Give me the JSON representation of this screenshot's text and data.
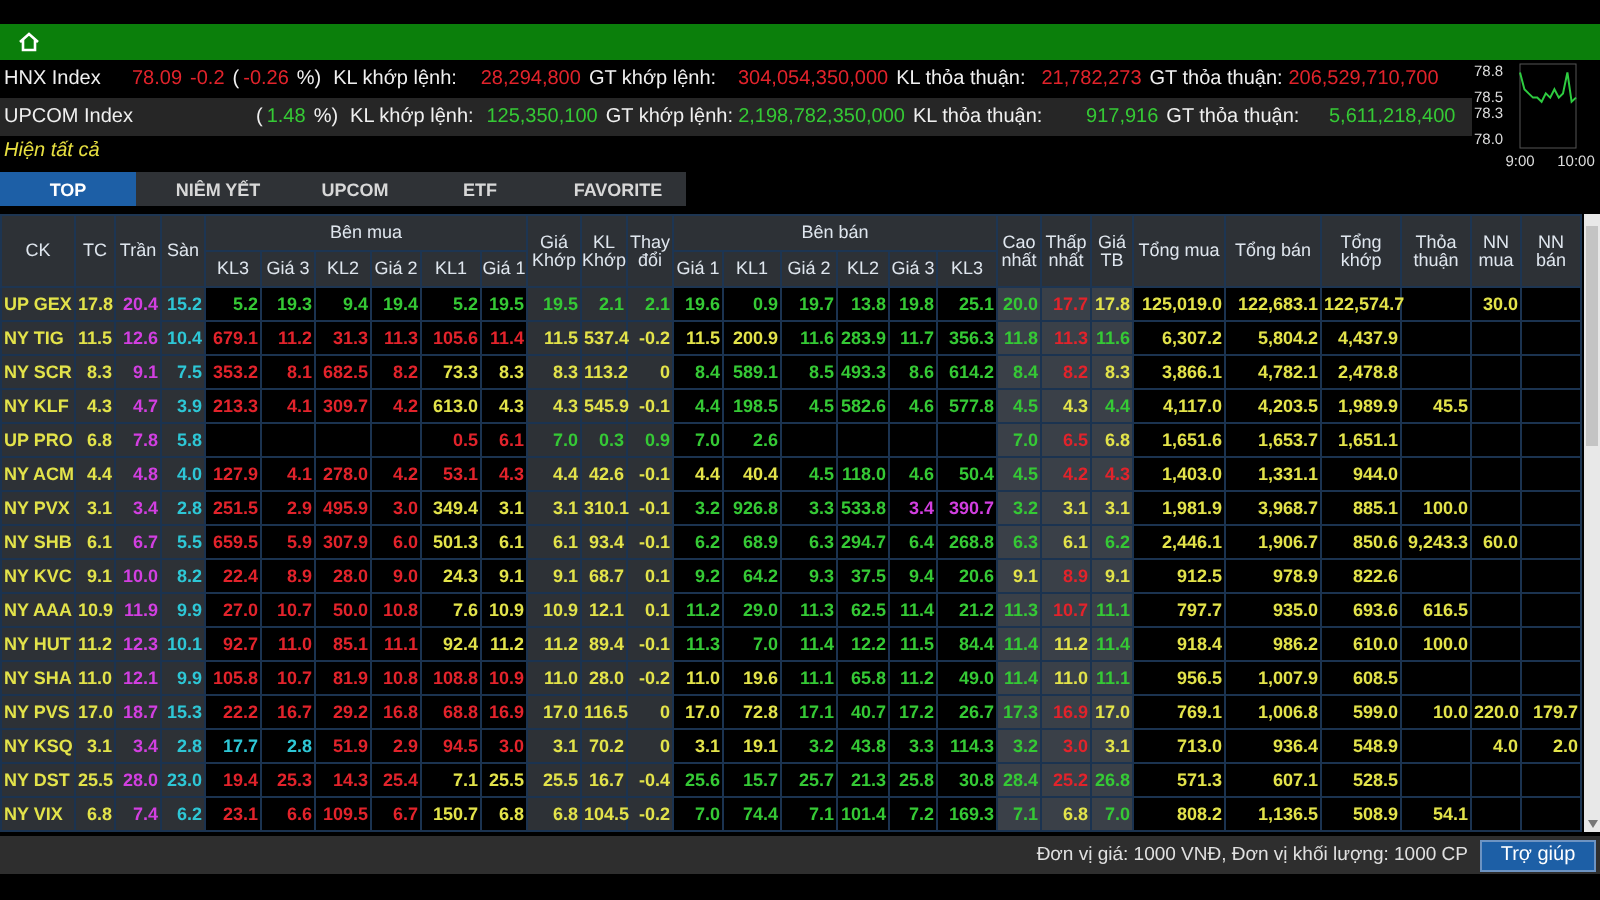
{
  "indices": [
    {
      "name": "HNX Index",
      "color": "#e2232b",
      "value": "78.09",
      "change": "-0.2",
      "pct_open": "(",
      "pct": "-0.26",
      "pct_close": "%)",
      "stats": [
        {
          "label": "KL khớp lệnh:",
          "value": "28,294,800"
        },
        {
          "label": "GT khớp lệnh:",
          "value": "304,054,350,000"
        },
        {
          "label": "KL thỏa thuận:",
          "value": "21,782,273"
        },
        {
          "label": "GT thỏa thuận:",
          "value": "206,529,710,700"
        }
      ]
    },
    {
      "name": "UPCOM Index",
      "color": "#35c935",
      "pct_open": "(",
      "pct": "1.48",
      "pct_close": "%)",
      "stats": [
        {
          "label": "KL khớp lệnh:",
          "value": "125,350,100"
        },
        {
          "label": "GT khớp lệnh:",
          "value": "2,198,782,350,000"
        },
        {
          "label": "KL thỏa thuận:",
          "value": "917,916"
        },
        {
          "label": "GT thỏa thuận:",
          "value": "5,611,218,400"
        }
      ]
    }
  ],
  "show_all": "Hiện tất cả",
  "mini_chart": {
    "chart_data": {
      "type": "line",
      "ylim": [
        77.9,
        78.9
      ],
      "yticks": [
        {
          "value": 78.0,
          "label": "78.0"
        },
        {
          "value": 78.3,
          "label": "78.3"
        },
        {
          "value": 78.5,
          "label": "78.5"
        },
        {
          "value": 78.8,
          "label": "78.8"
        }
      ],
      "categories": [
        "9:00",
        null,
        null,
        null,
        null,
        null,
        null,
        null,
        null,
        null,
        null,
        null,
        null,
        "10:00"
      ],
      "series": [
        {
          "color": "#2ecc40",
          "values": [
            78.8,
            78.6,
            78.55,
            78.5,
            78.5,
            78.45,
            78.55,
            78.5,
            78.6,
            78.5,
            78.55,
            78.8,
            78.45,
            78.5
          ]
        }
      ]
    }
  },
  "tabs": [
    {
      "label": "TOP",
      "selected": true
    },
    {
      "label": "NIÊM YẾT",
      "selected": false
    },
    {
      "label": "UPCOM",
      "selected": false
    },
    {
      "label": "ETF",
      "selected": false
    },
    {
      "label": "FAVORITE",
      "selected": false
    }
  ],
  "table": {
    "columns": [
      {
        "label": "CK"
      },
      {
        "label": "TC"
      },
      {
        "label": "Trần"
      },
      {
        "label": "Sàn"
      },
      {
        "label": "Bên mua",
        "colspan": 6,
        "children": [
          {
            "label": "KL3"
          },
          {
            "label": "Giá 3"
          },
          {
            "label": "KL2"
          },
          {
            "label": "Giá 2"
          },
          {
            "label": "KL1"
          },
          {
            "label": "Giá 1"
          }
        ]
      },
      {
        "label": "Giá Khớp"
      },
      {
        "label": "KL Khớp"
      },
      {
        "label": "Thay đổi"
      },
      {
        "label": "Bên bán",
        "colspan": 6,
        "children": [
          {
            "label": "Giá 1"
          },
          {
            "label": "KL1"
          },
          {
            "label": "Giá 2"
          },
          {
            "label": "KL2"
          },
          {
            "label": "Giá 3"
          },
          {
            "label": "KL3"
          }
        ]
      },
      {
        "label": "Cao nhất"
      },
      {
        "label": "Thấp nhất"
      },
      {
        "label": "Giá TB"
      },
      {
        "label": "Tổng mua"
      },
      {
        "label": "Tổng bán"
      },
      {
        "label": "Tổng khớp"
      },
      {
        "label": "Thỏa thuận"
      },
      {
        "label": "NN mua"
      },
      {
        "label": "NN bán"
      }
    ],
    "rows": [
      {
        "cells": [
          {
            "text": "UP GEX"
          },
          {
            "text": "17.8",
            "kind": "ref"
          },
          {
            "text": "20.4",
            "kind": "ceil"
          },
          {
            "text": "15.2",
            "kind": "floor"
          },
          {
            "text": "5.2",
            "kind": "up"
          },
          {
            "text": "19.3",
            "kind": "up"
          },
          {
            "text": "9.4",
            "kind": "up"
          },
          {
            "text": "19.4",
            "kind": "up"
          },
          {
            "text": "5.2",
            "kind": "up"
          },
          {
            "text": "19.5",
            "kind": "up"
          },
          {
            "text": "19.5",
            "kind": "up"
          },
          {
            "text": "2.1",
            "kind": "up"
          },
          {
            "text": "2.1",
            "kind": "up"
          },
          {
            "text": "19.6",
            "kind": "up"
          },
          {
            "text": "0.9",
            "kind": "up"
          },
          {
            "text": "19.7",
            "kind": "up"
          },
          {
            "text": "13.8",
            "kind": "up"
          },
          {
            "text": "19.8",
            "kind": "up"
          },
          {
            "text": "25.1",
            "kind": "up"
          },
          {
            "text": "20.0",
            "kind": "up"
          },
          {
            "text": "17.7",
            "kind": "down"
          },
          {
            "text": "17.8",
            "kind": "ref"
          },
          {
            "text": "125,019.0",
            "kind": "ref"
          },
          {
            "text": "122,683.1",
            "kind": "ref"
          },
          {
            "text": "122,574.7",
            "kind": "ref"
          },
          "",
          {
            "text": "30.0",
            "kind": "ref"
          },
          ""
        ]
      },
      {
        "cells": [
          {
            "text": "NY TIG"
          },
          {
            "text": "11.5",
            "kind": "ref"
          },
          {
            "text": "12.6",
            "kind": "ceil"
          },
          {
            "text": "10.4",
            "kind": "floor"
          },
          {
            "text": "679.1",
            "kind": "down"
          },
          {
            "text": "11.2",
            "kind": "down"
          },
          {
            "text": "31.3",
            "kind": "down"
          },
          {
            "text": "11.3",
            "kind": "down"
          },
          {
            "text": "105.6",
            "kind": "down"
          },
          {
            "text": "11.4",
            "kind": "down"
          },
          {
            "text": "11.5",
            "kind": "ref"
          },
          {
            "text": "537.4",
            "kind": "ref"
          },
          {
            "text": "-0.2",
            "kind": "ref"
          },
          {
            "text": "11.5",
            "kind": "ref"
          },
          {
            "text": "200.9",
            "kind": "ref"
          },
          {
            "text": "11.6",
            "kind": "up"
          },
          {
            "text": "283.9",
            "kind": "up"
          },
          {
            "text": "11.7",
            "kind": "up"
          },
          {
            "text": "356.3",
            "kind": "up"
          },
          {
            "text": "11.8",
            "kind": "up"
          },
          {
            "text": "11.3",
            "kind": "down"
          },
          {
            "text": "11.6",
            "kind": "up"
          },
          {
            "text": "6,307.2",
            "kind": "ref"
          },
          {
            "text": "5,804.2",
            "kind": "ref"
          },
          {
            "text": "4,437.9",
            "kind": "ref"
          },
          "",
          "",
          ""
        ]
      },
      {
        "cells": [
          {
            "text": "NY SCR"
          },
          {
            "text": "8.3",
            "kind": "ref"
          },
          {
            "text": "9.1",
            "kind": "ceil"
          },
          {
            "text": "7.5",
            "kind": "floor"
          },
          {
            "text": "353.2",
            "kind": "down"
          },
          {
            "text": "8.1",
            "kind": "down"
          },
          {
            "text": "682.5",
            "kind": "down"
          },
          {
            "text": "8.2",
            "kind": "down"
          },
          {
            "text": "73.3",
            "kind": "ref"
          },
          {
            "text": "8.3",
            "kind": "ref"
          },
          {
            "text": "8.3",
            "kind": "ref"
          },
          {
            "text": "113.2",
            "kind": "ref"
          },
          {
            "text": "0",
            "kind": "ref"
          },
          {
            "text": "8.4",
            "kind": "up"
          },
          {
            "text": "589.1",
            "kind": "up"
          },
          {
            "text": "8.5",
            "kind": "up"
          },
          {
            "text": "493.3",
            "kind": "up"
          },
          {
            "text": "8.6",
            "kind": "up"
          },
          {
            "text": "614.2",
            "kind": "up"
          },
          {
            "text": "8.4",
            "kind": "up"
          },
          {
            "text": "8.2",
            "kind": "down"
          },
          {
            "text": "8.3",
            "kind": "ref"
          },
          {
            "text": "3,866.1",
            "kind": "ref"
          },
          {
            "text": "4,782.1",
            "kind": "ref"
          },
          {
            "text": "2,478.8",
            "kind": "ref"
          },
          "",
          "",
          ""
        ]
      },
      {
        "cells": [
          {
            "text": "NY KLF"
          },
          {
            "text": "4.3",
            "kind": "ref"
          },
          {
            "text": "4.7",
            "kind": "ceil"
          },
          {
            "text": "3.9",
            "kind": "floor"
          },
          {
            "text": "213.3",
            "kind": "down"
          },
          {
            "text": "4.1",
            "kind": "down"
          },
          {
            "text": "309.7",
            "kind": "down"
          },
          {
            "text": "4.2",
            "kind": "down"
          },
          {
            "text": "613.0",
            "kind": "ref"
          },
          {
            "text": "4.3",
            "kind": "ref"
          },
          {
            "text": "4.3",
            "kind": "ref"
          },
          {
            "text": "545.9",
            "kind": "ref"
          },
          {
            "text": "-0.1",
            "kind": "ref"
          },
          {
            "text": "4.4",
            "kind": "up"
          },
          {
            "text": "198.5",
            "kind": "up"
          },
          {
            "text": "4.5",
            "kind": "up"
          },
          {
            "text": "582.6",
            "kind": "up"
          },
          {
            "text": "4.6",
            "kind": "up"
          },
          {
            "text": "577.8",
            "kind": "up"
          },
          {
            "text": "4.5",
            "kind": "up"
          },
          {
            "text": "4.3",
            "kind": "ref"
          },
          {
            "text": "4.4",
            "kind": "up"
          },
          {
            "text": "4,117.0",
            "kind": "ref"
          },
          {
            "text": "4,203.5",
            "kind": "ref"
          },
          {
            "text": "1,989.9",
            "kind": "ref"
          },
          {
            "text": "45.5",
            "kind": "ref"
          },
          "",
          ""
        ]
      },
      {
        "cells": [
          {
            "text": "UP PRO"
          },
          {
            "text": "6.8",
            "kind": "ref"
          },
          {
            "text": "7.8",
            "kind": "ceil"
          },
          {
            "text": "5.8",
            "kind": "floor"
          },
          "",
          "",
          "",
          "",
          {
            "text": "0.5",
            "kind": "down"
          },
          {
            "text": "6.1",
            "kind": "down"
          },
          {
            "text": "7.0",
            "kind": "up"
          },
          {
            "text": "0.3",
            "kind": "up"
          },
          {
            "text": "0.9",
            "kind": "up"
          },
          {
            "text": "7.0",
            "kind": "up"
          },
          {
            "text": "2.6",
            "kind": "up"
          },
          "",
          "",
          "",
          "",
          {
            "text": "7.0",
            "kind": "up"
          },
          {
            "text": "6.5",
            "kind": "down"
          },
          {
            "text": "6.8",
            "kind": "ref"
          },
          {
            "text": "1,651.6",
            "kind": "ref"
          },
          {
            "text": "1,653.7",
            "kind": "ref"
          },
          {
            "text": "1,651.1",
            "kind": "ref"
          },
          "",
          "",
          ""
        ]
      },
      {
        "cells": [
          {
            "text": "NY ACM"
          },
          {
            "text": "4.4",
            "kind": "ref"
          },
          {
            "text": "4.8",
            "kind": "ceil"
          },
          {
            "text": "4.0",
            "kind": "floor"
          },
          {
            "text": "127.9",
            "kind": "down"
          },
          {
            "text": "4.1",
            "kind": "down"
          },
          {
            "text": "278.0",
            "kind": "down"
          },
          {
            "text": "4.2",
            "kind": "down"
          },
          {
            "text": "53.1",
            "kind": "down"
          },
          {
            "text": "4.3",
            "kind": "down"
          },
          {
            "text": "4.4",
            "kind": "ref"
          },
          {
            "text": "42.6",
            "kind": "ref"
          },
          {
            "text": "-0.1",
            "kind": "ref"
          },
          {
            "text": "4.4",
            "kind": "ref"
          },
          {
            "text": "40.4",
            "kind": "ref"
          },
          {
            "text": "4.5",
            "kind": "up"
          },
          {
            "text": "118.0",
            "kind": "up"
          },
          {
            "text": "4.6",
            "kind": "up"
          },
          {
            "text": "50.4",
            "kind": "up"
          },
          {
            "text": "4.5",
            "kind": "up"
          },
          {
            "text": "4.2",
            "kind": "down"
          },
          {
            "text": "4.3",
            "kind": "down"
          },
          {
            "text": "1,403.0",
            "kind": "ref"
          },
          {
            "text": "1,331.1",
            "kind": "ref"
          },
          {
            "text": "944.0",
            "kind": "ref"
          },
          "",
          "",
          ""
        ]
      },
      {
        "cells": [
          {
            "text": "NY PVX"
          },
          {
            "text": "3.1",
            "kind": "ref"
          },
          {
            "text": "3.4",
            "kind": "ceil"
          },
          {
            "text": "2.8",
            "kind": "floor"
          },
          {
            "text": "251.5",
            "kind": "down"
          },
          {
            "text": "2.9",
            "kind": "down"
          },
          {
            "text": "495.9",
            "kind": "down"
          },
          {
            "text": "3.0",
            "kind": "down"
          },
          {
            "text": "349.4",
            "kind": "ref"
          },
          {
            "text": "3.1",
            "kind": "ref"
          },
          {
            "text": "3.1",
            "kind": "ref"
          },
          {
            "text": "310.1",
            "kind": "ref"
          },
          {
            "text": "-0.1",
            "kind": "ref"
          },
          {
            "text": "3.2",
            "kind": "up"
          },
          {
            "text": "926.8",
            "kind": "up"
          },
          {
            "text": "3.3",
            "kind": "up"
          },
          {
            "text": "533.8",
            "kind": "up"
          },
          {
            "text": "3.4",
            "kind": "ceil"
          },
          {
            "text": "390.7",
            "kind": "ceil"
          },
          {
            "text": "3.2",
            "kind": "up"
          },
          {
            "text": "3.1",
            "kind": "ref"
          },
          {
            "text": "3.1",
            "kind": "ref"
          },
          {
            "text": "1,981.9",
            "kind": "ref"
          },
          {
            "text": "3,968.7",
            "kind": "ref"
          },
          {
            "text": "885.1",
            "kind": "ref"
          },
          {
            "text": "100.0",
            "kind": "ref"
          },
          "",
          ""
        ]
      },
      {
        "cells": [
          {
            "text": "NY SHB"
          },
          {
            "text": "6.1",
            "kind": "ref"
          },
          {
            "text": "6.7",
            "kind": "ceil"
          },
          {
            "text": "5.5",
            "kind": "floor"
          },
          {
            "text": "659.5",
            "kind": "down"
          },
          {
            "text": "5.9",
            "kind": "down"
          },
          {
            "text": "307.9",
            "kind": "down"
          },
          {
            "text": "6.0",
            "kind": "down"
          },
          {
            "text": "501.3",
            "kind": "ref"
          },
          {
            "text": "6.1",
            "kind": "ref"
          },
          {
            "text": "6.1",
            "kind": "ref"
          },
          {
            "text": "93.4",
            "kind": "ref"
          },
          {
            "text": "-0.1",
            "kind": "ref"
          },
          {
            "text": "6.2",
            "kind": "up"
          },
          {
            "text": "68.9",
            "kind": "up"
          },
          {
            "text": "6.3",
            "kind": "up"
          },
          {
            "text": "294.7",
            "kind": "up"
          },
          {
            "text": "6.4",
            "kind": "up"
          },
          {
            "text": "268.8",
            "kind": "up"
          },
          {
            "text": "6.3",
            "kind": "up"
          },
          {
            "text": "6.1",
            "kind": "ref"
          },
          {
            "text": "6.2",
            "kind": "up"
          },
          {
            "text": "2,446.1",
            "kind": "ref"
          },
          {
            "text": "1,906.7",
            "kind": "ref"
          },
          {
            "text": "850.6",
            "kind": "ref"
          },
          {
            "text": "9,243.3",
            "kind": "ref"
          },
          {
            "text": "60.0",
            "kind": "ref"
          },
          ""
        ]
      },
      {
        "cells": [
          {
            "text": "NY KVC"
          },
          {
            "text": "9.1",
            "kind": "ref"
          },
          {
            "text": "10.0",
            "kind": "ceil"
          },
          {
            "text": "8.2",
            "kind": "floor"
          },
          {
            "text": "22.4",
            "kind": "down"
          },
          {
            "text": "8.9",
            "kind": "down"
          },
          {
            "text": "28.0",
            "kind": "down"
          },
          {
            "text": "9.0",
            "kind": "down"
          },
          {
            "text": "24.3",
            "kind": "ref"
          },
          {
            "text": "9.1",
            "kind": "ref"
          },
          {
            "text": "9.1",
            "kind": "ref"
          },
          {
            "text": "68.7",
            "kind": "ref"
          },
          {
            "text": "0.1",
            "kind": "ref"
          },
          {
            "text": "9.2",
            "kind": "up"
          },
          {
            "text": "64.2",
            "kind": "up"
          },
          {
            "text": "9.3",
            "kind": "up"
          },
          {
            "text": "37.5",
            "kind": "up"
          },
          {
            "text": "9.4",
            "kind": "up"
          },
          {
            "text": "20.6",
            "kind": "up"
          },
          {
            "text": "9.1",
            "kind": "ref"
          },
          {
            "text": "8.9",
            "kind": "down"
          },
          {
            "text": "9.1",
            "kind": "ref"
          },
          {
            "text": "912.5",
            "kind": "ref"
          },
          {
            "text": "978.9",
            "kind": "ref"
          },
          {
            "text": "822.6",
            "kind": "ref"
          },
          "",
          "",
          ""
        ]
      },
      {
        "cells": [
          {
            "text": "NY AAA"
          },
          {
            "text": "10.9",
            "kind": "ref"
          },
          {
            "text": "11.9",
            "kind": "ceil"
          },
          {
            "text": "9.9",
            "kind": "floor"
          },
          {
            "text": "27.0",
            "kind": "down"
          },
          {
            "text": "10.7",
            "kind": "down"
          },
          {
            "text": "50.0",
            "kind": "down"
          },
          {
            "text": "10.8",
            "kind": "down"
          },
          {
            "text": "7.6",
            "kind": "ref"
          },
          {
            "text": "10.9",
            "kind": "ref"
          },
          {
            "text": "10.9",
            "kind": "ref"
          },
          {
            "text": "12.1",
            "kind": "ref"
          },
          {
            "text": "0.1",
            "kind": "ref"
          },
          {
            "text": "11.2",
            "kind": "up"
          },
          {
            "text": "29.0",
            "kind": "up"
          },
          {
            "text": "11.3",
            "kind": "up"
          },
          {
            "text": "62.5",
            "kind": "up"
          },
          {
            "text": "11.4",
            "kind": "up"
          },
          {
            "text": "21.2",
            "kind": "up"
          },
          {
            "text": "11.3",
            "kind": "up"
          },
          {
            "text": "10.7",
            "kind": "down"
          },
          {
            "text": "11.1",
            "kind": "up"
          },
          {
            "text": "797.7",
            "kind": "ref"
          },
          {
            "text": "935.0",
            "kind": "ref"
          },
          {
            "text": "693.6",
            "kind": "ref"
          },
          {
            "text": "616.5",
            "kind": "ref"
          },
          "",
          ""
        ]
      },
      {
        "cells": [
          {
            "text": "NY HUT"
          },
          {
            "text": "11.2",
            "kind": "ref"
          },
          {
            "text": "12.3",
            "kind": "ceil"
          },
          {
            "text": "10.1",
            "kind": "floor"
          },
          {
            "text": "92.7",
            "kind": "down"
          },
          {
            "text": "11.0",
            "kind": "down"
          },
          {
            "text": "85.1",
            "kind": "down"
          },
          {
            "text": "11.1",
            "kind": "down"
          },
          {
            "text": "92.4",
            "kind": "ref"
          },
          {
            "text": "11.2",
            "kind": "ref"
          },
          {
            "text": "11.2",
            "kind": "ref"
          },
          {
            "text": "89.4",
            "kind": "ref"
          },
          {
            "text": "-0.1",
            "kind": "ref"
          },
          {
            "text": "11.3",
            "kind": "up"
          },
          {
            "text": "7.0",
            "kind": "up"
          },
          {
            "text": "11.4",
            "kind": "up"
          },
          {
            "text": "12.2",
            "kind": "up"
          },
          {
            "text": "11.5",
            "kind": "up"
          },
          {
            "text": "84.4",
            "kind": "up"
          },
          {
            "text": "11.4",
            "kind": "up"
          },
          {
            "text": "11.2",
            "kind": "ref"
          },
          {
            "text": "11.4",
            "kind": "up"
          },
          {
            "text": "918.4",
            "kind": "ref"
          },
          {
            "text": "986.2",
            "kind": "ref"
          },
          {
            "text": "610.0",
            "kind": "ref"
          },
          {
            "text": "100.0",
            "kind": "ref"
          },
          "",
          ""
        ]
      },
      {
        "cells": [
          {
            "text": "NY SHA"
          },
          {
            "text": "11.0",
            "kind": "ref"
          },
          {
            "text": "12.1",
            "kind": "ceil"
          },
          {
            "text": "9.9",
            "kind": "floor"
          },
          {
            "text": "105.8",
            "kind": "down"
          },
          {
            "text": "10.7",
            "kind": "down"
          },
          {
            "text": "81.9",
            "kind": "down"
          },
          {
            "text": "10.8",
            "kind": "down"
          },
          {
            "text": "108.8",
            "kind": "down"
          },
          {
            "text": "10.9",
            "kind": "down"
          },
          {
            "text": "11.0",
            "kind": "ref"
          },
          {
            "text": "28.0",
            "kind": "ref"
          },
          {
            "text": "-0.2",
            "kind": "ref"
          },
          {
            "text": "11.0",
            "kind": "ref"
          },
          {
            "text": "19.6",
            "kind": "ref"
          },
          {
            "text": "11.1",
            "kind": "up"
          },
          {
            "text": "65.8",
            "kind": "up"
          },
          {
            "text": "11.2",
            "kind": "up"
          },
          {
            "text": "49.0",
            "kind": "up"
          },
          {
            "text": "11.4",
            "kind": "up"
          },
          {
            "text": "11.0",
            "kind": "ref"
          },
          {
            "text": "11.1",
            "kind": "up"
          },
          {
            "text": "956.5",
            "kind": "ref"
          },
          {
            "text": "1,007.9",
            "kind": "ref"
          },
          {
            "text": "608.5",
            "kind": "ref"
          },
          "",
          "",
          ""
        ]
      },
      {
        "cells": [
          {
            "text": "NY PVS"
          },
          {
            "text": "17.0",
            "kind": "ref"
          },
          {
            "text": "18.7",
            "kind": "ceil"
          },
          {
            "text": "15.3",
            "kind": "floor"
          },
          {
            "text": "22.2",
            "kind": "down"
          },
          {
            "text": "16.7",
            "kind": "down"
          },
          {
            "text": "29.2",
            "kind": "down"
          },
          {
            "text": "16.8",
            "kind": "down"
          },
          {
            "text": "68.8",
            "kind": "down"
          },
          {
            "text": "16.9",
            "kind": "down"
          },
          {
            "text": "17.0",
            "kind": "ref"
          },
          {
            "text": "116.5",
            "kind": "ref"
          },
          {
            "text": "0",
            "kind": "ref"
          },
          {
            "text": "17.0",
            "kind": "ref"
          },
          {
            "text": "72.8",
            "kind": "ref"
          },
          {
            "text": "17.1",
            "kind": "up"
          },
          {
            "text": "40.7",
            "kind": "up"
          },
          {
            "text": "17.2",
            "kind": "up"
          },
          {
            "text": "26.7",
            "kind": "up"
          },
          {
            "text": "17.3",
            "kind": "up"
          },
          {
            "text": "16.9",
            "kind": "down"
          },
          {
            "text": "17.0",
            "kind": "ref"
          },
          {
            "text": "769.1",
            "kind": "ref"
          },
          {
            "text": "1,006.8",
            "kind": "ref"
          },
          {
            "text": "599.0",
            "kind": "ref"
          },
          {
            "text": "10.0",
            "kind": "ref"
          },
          {
            "text": "220.0",
            "kind": "ref"
          },
          {
            "text": "179.7",
            "kind": "ref"
          }
        ]
      },
      {
        "cells": [
          {
            "text": "NY KSQ"
          },
          {
            "text": "3.1",
            "kind": "ref"
          },
          {
            "text": "3.4",
            "kind": "ceil"
          },
          {
            "text": "2.8",
            "kind": "floor"
          },
          {
            "text": "17.7",
            "kind": "floor"
          },
          {
            "text": "2.8",
            "kind": "floor"
          },
          {
            "text": "51.9",
            "kind": "down"
          },
          {
            "text": "2.9",
            "kind": "down"
          },
          {
            "text": "94.5",
            "kind": "down"
          },
          {
            "text": "3.0",
            "kind": "down"
          },
          {
            "text": "3.1",
            "kind": "ref"
          },
          {
            "text": "70.2",
            "kind": "ref"
          },
          {
            "text": "0",
            "kind": "ref"
          },
          {
            "text": "3.1",
            "kind": "ref"
          },
          {
            "text": "19.1",
            "kind": "ref"
          },
          {
            "text": "3.2",
            "kind": "up"
          },
          {
            "text": "43.8",
            "kind": "up"
          },
          {
            "text": "3.3",
            "kind": "up"
          },
          {
            "text": "114.3",
            "kind": "up"
          },
          {
            "text": "3.2",
            "kind": "up"
          },
          {
            "text": "3.0",
            "kind": "down"
          },
          {
            "text": "3.1",
            "kind": "ref"
          },
          {
            "text": "713.0",
            "kind": "ref"
          },
          {
            "text": "936.4",
            "kind": "ref"
          },
          {
            "text": "548.9",
            "kind": "ref"
          },
          "",
          {
            "text": "4.0",
            "kind": "ref"
          },
          {
            "text": "2.0",
            "kind": "ref"
          }
        ]
      },
      {
        "cells": [
          {
            "text": "NY DST"
          },
          {
            "text": "25.5",
            "kind": "ref"
          },
          {
            "text": "28.0",
            "kind": "ceil"
          },
          {
            "text": "23.0",
            "kind": "floor"
          },
          {
            "text": "19.4",
            "kind": "down"
          },
          {
            "text": "25.3",
            "kind": "down"
          },
          {
            "text": "14.3",
            "kind": "down"
          },
          {
            "text": "25.4",
            "kind": "down"
          },
          {
            "text": "7.1",
            "kind": "ref"
          },
          {
            "text": "25.5",
            "kind": "ref"
          },
          {
            "text": "25.5",
            "kind": "ref"
          },
          {
            "text": "16.7",
            "kind": "ref"
          },
          {
            "text": "-0.4",
            "kind": "ref"
          },
          {
            "text": "25.6",
            "kind": "up"
          },
          {
            "text": "15.7",
            "kind": "up"
          },
          {
            "text": "25.7",
            "kind": "up"
          },
          {
            "text": "21.3",
            "kind": "up"
          },
          {
            "text": "25.8",
            "kind": "up"
          },
          {
            "text": "30.8",
            "kind": "up"
          },
          {
            "text": "28.4",
            "kind": "up"
          },
          {
            "text": "25.2",
            "kind": "down"
          },
          {
            "text": "26.8",
            "kind": "up"
          },
          {
            "text": "571.3",
            "kind": "ref"
          },
          {
            "text": "607.1",
            "kind": "ref"
          },
          {
            "text": "528.5",
            "kind": "ref"
          },
          "",
          "",
          ""
        ]
      },
      {
        "cells": [
          {
            "text": "NY VIX"
          },
          {
            "text": "6.8",
            "kind": "ref"
          },
          {
            "text": "7.4",
            "kind": "ceil"
          },
          {
            "text": "6.2",
            "kind": "floor"
          },
          {
            "text": "23.1",
            "kind": "down"
          },
          {
            "text": "6.6",
            "kind": "down"
          },
          {
            "text": "109.5",
            "kind": "down"
          },
          {
            "text": "6.7",
            "kind": "down"
          },
          {
            "text": "150.7",
            "kind": "ref"
          },
          {
            "text": "6.8",
            "kind": "ref"
          },
          {
            "text": "6.8",
            "kind": "ref"
          },
          {
            "text": "104.5",
            "kind": "ref"
          },
          {
            "text": "-0.2",
            "kind": "ref"
          },
          {
            "text": "7.0",
            "kind": "up"
          },
          {
            "text": "74.4",
            "kind": "up"
          },
          {
            "text": "7.1",
            "kind": "up"
          },
          {
            "text": "101.4",
            "kind": "up"
          },
          {
            "text": "7.2",
            "kind": "up"
          },
          {
            "text": "169.3",
            "kind": "up"
          },
          {
            "text": "7.1",
            "kind": "up"
          },
          {
            "text": "6.8",
            "kind": "ref"
          },
          {
            "text": "7.0",
            "kind": "up"
          },
          {
            "text": "808.2",
            "kind": "ref"
          },
          {
            "text": "1,136.5",
            "kind": "ref"
          },
          {
            "text": "508.9",
            "kind": "ref"
          },
          {
            "text": "54.1",
            "kind": "ref"
          },
          "",
          ""
        ]
      }
    ]
  },
  "footer": {
    "note": "Đơn vị giá: 1000 VNĐ, Đơn vị khối lượng: 1000 CP",
    "help_button": "Trợ giúp"
  }
}
